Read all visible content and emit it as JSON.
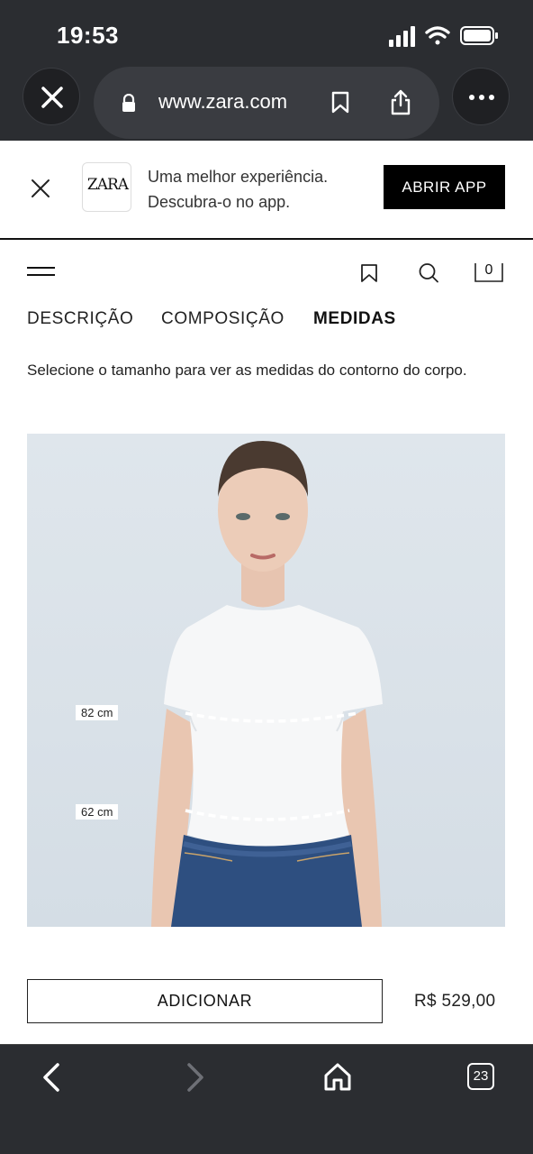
{
  "status_bar": {
    "time": "19:53"
  },
  "browser": {
    "url": "www.zara.com",
    "tabs_count": "23"
  },
  "app_banner": {
    "logo": "ZARA",
    "line1": "Uma melhor experiência.",
    "line2": "Descubra-o no app.",
    "cta": "ABRIR APP"
  },
  "header": {
    "cart_count": "0"
  },
  "tabs": [
    {
      "label": "DESCRIÇÃO",
      "active": false
    },
    {
      "label": "COMPOSIÇÃO",
      "active": false
    },
    {
      "label": "MEDIDAS",
      "active": true
    }
  ],
  "description": "Selecione o tamanho para ver as medidas do contorno do corpo.",
  "measurements": {
    "chest": "82 cm",
    "waist": "62 cm"
  },
  "actions": {
    "add_label": "ADICIONAR",
    "price": "R$ 529,00"
  }
}
